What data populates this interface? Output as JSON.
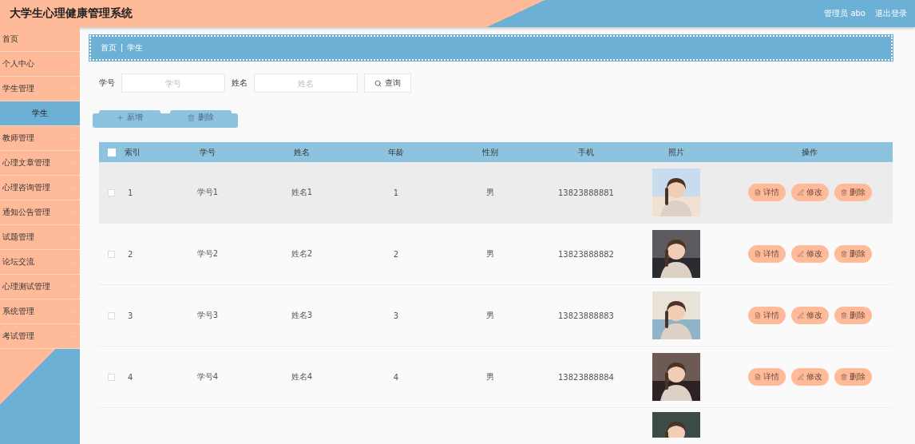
{
  "header": {
    "title": "大学生心理健康管理系统",
    "user": "管理员 abo",
    "logout": "退出登录"
  },
  "sidebar": {
    "items": [
      {
        "label": "首页",
        "expandable": false,
        "selected": false
      },
      {
        "label": "个人中心",
        "expandable": true,
        "selected": false
      },
      {
        "label": "学生管理",
        "expandable": true,
        "selected": false,
        "children": [
          {
            "label": "学生",
            "selected": true
          }
        ]
      },
      {
        "label": "教师管理",
        "expandable": true,
        "selected": false
      },
      {
        "label": "心理文章管理",
        "expandable": true,
        "selected": false
      },
      {
        "label": "心理咨询管理",
        "expandable": true,
        "selected": false
      },
      {
        "label": "通知公告管理",
        "expandable": true,
        "selected": false
      },
      {
        "label": "试题管理",
        "expandable": true,
        "selected": false
      },
      {
        "label": "论坛交流",
        "expandable": true,
        "selected": false
      },
      {
        "label": "心理测试管理",
        "expandable": true,
        "selected": false
      },
      {
        "label": "系统管理",
        "expandable": true,
        "selected": false
      },
      {
        "label": "考试管理",
        "expandable": true,
        "selected": false
      }
    ]
  },
  "breadcrumb": [
    "首页",
    "学生"
  ],
  "search": {
    "fields": [
      {
        "label": "学号",
        "placeholder": "学号"
      },
      {
        "label": "姓名",
        "placeholder": "姓名"
      }
    ],
    "button": "查询"
  },
  "actions": [
    {
      "kind": "add",
      "label": "新增"
    },
    {
      "kind": "delete",
      "label": "删除"
    }
  ],
  "table": {
    "select_all": {
      "checked": false
    },
    "columns": [
      "索引",
      "学号",
      "姓名",
      "年龄",
      "性别",
      "手机",
      "照片",
      "操作"
    ],
    "rows": [
      {
        "cells": [
          "1",
          "学号1",
          "姓名1",
          "1",
          "男",
          "13823888881"
        ],
        "photo": {
          "kind": "picture"
        },
        "highlighted": true,
        "checked": false,
        "buttons": [
          {
            "kind": "detail",
            "label": "详情"
          },
          {
            "kind": "edit",
            "label": "修改"
          },
          {
            "kind": "delete",
            "label": "删除"
          }
        ]
      },
      {
        "cells": [
          "2",
          "学号2",
          "姓名2",
          "2",
          "男",
          "13823888882"
        ],
        "photo": {
          "kind": "picture"
        },
        "highlighted": false,
        "checked": false,
        "buttons": [
          {
            "kind": "detail",
            "label": "详情"
          },
          {
            "kind": "edit",
            "label": "修改"
          },
          {
            "kind": "delete",
            "label": "删除"
          }
        ]
      },
      {
        "cells": [
          "3",
          "学号3",
          "姓名3",
          "3",
          "男",
          "13823888883"
        ],
        "photo": {
          "kind": "picture"
        },
        "highlighted": false,
        "checked": false,
        "buttons": [
          {
            "kind": "detail",
            "label": "详情"
          },
          {
            "kind": "edit",
            "label": "修改"
          },
          {
            "kind": "delete",
            "label": "删除"
          }
        ]
      },
      {
        "cells": [
          "4",
          "学号4",
          "姓名4",
          "4",
          "男",
          "13823888884"
        ],
        "photo": {
          "kind": "picture"
        },
        "highlighted": false,
        "checked": false,
        "buttons": [
          {
            "kind": "detail",
            "label": "详情"
          },
          {
            "kind": "edit",
            "label": "修改"
          },
          {
            "kind": "delete",
            "label": "删除"
          }
        ]
      }
    ],
    "partial_row": {
      "photo": {
        "kind": "picture"
      }
    }
  }
}
